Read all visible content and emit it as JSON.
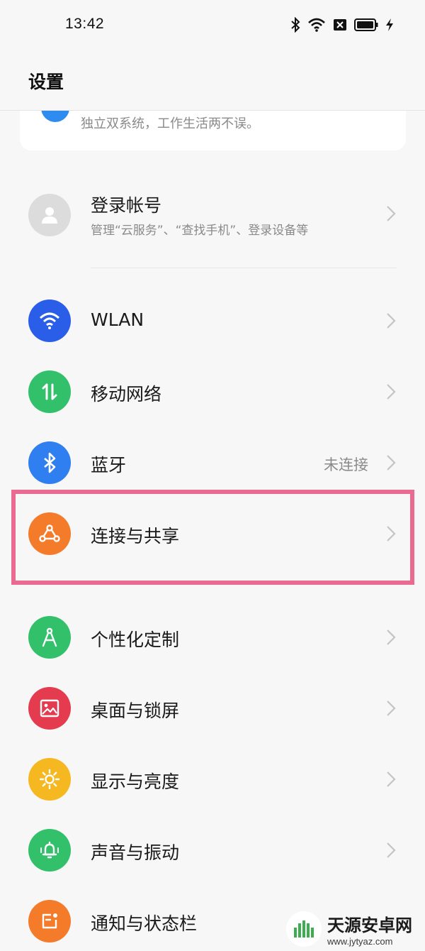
{
  "status": {
    "time": "13:42",
    "icons": [
      "bluetooth-icon",
      "wifi-icon",
      "sim-error-icon",
      "battery-icon",
      "charging-icon"
    ]
  },
  "header": {
    "title": "设置"
  },
  "top_card": {
    "description": "独立双系统，工作生活两不误。"
  },
  "account": {
    "label": "登录帐号",
    "sub": "管理“云服务”、“查找手机”、登录设备等",
    "icon": "avatar-icon"
  },
  "items": [
    {
      "label": "WLAN",
      "value": "",
      "icon": "wifi-icon",
      "color": "#2a5ee8"
    },
    {
      "label": "移动网络",
      "value": "",
      "icon": "mobile-data-icon",
      "color": "#33c06a"
    },
    {
      "label": "蓝牙",
      "value": "未连接",
      "icon": "bluetooth-icon",
      "color": "#2f7ff0"
    },
    {
      "label": "连接与共享",
      "value": "",
      "icon": "share-icon",
      "color": "#f47b2a"
    },
    {
      "label": "个性化定制",
      "value": "",
      "icon": "compass-icon",
      "color": "#33c06a"
    },
    {
      "label": "桌面与锁屏",
      "value": "",
      "icon": "image-icon",
      "color": "#e43b4f"
    },
    {
      "label": "显示与亮度",
      "value": "",
      "icon": "sun-icon",
      "color": "#f6b820"
    },
    {
      "label": "声音与振动",
      "value": "",
      "icon": "bell-icon",
      "color": "#33c06a"
    },
    {
      "label": "通知与状态栏",
      "value": "",
      "icon": "notification-icon",
      "color": "#f47b2a"
    }
  ],
  "highlight_color": "#ea6b92",
  "watermark": {
    "title": "天源安卓网",
    "url": "www.jytyaz.com"
  }
}
